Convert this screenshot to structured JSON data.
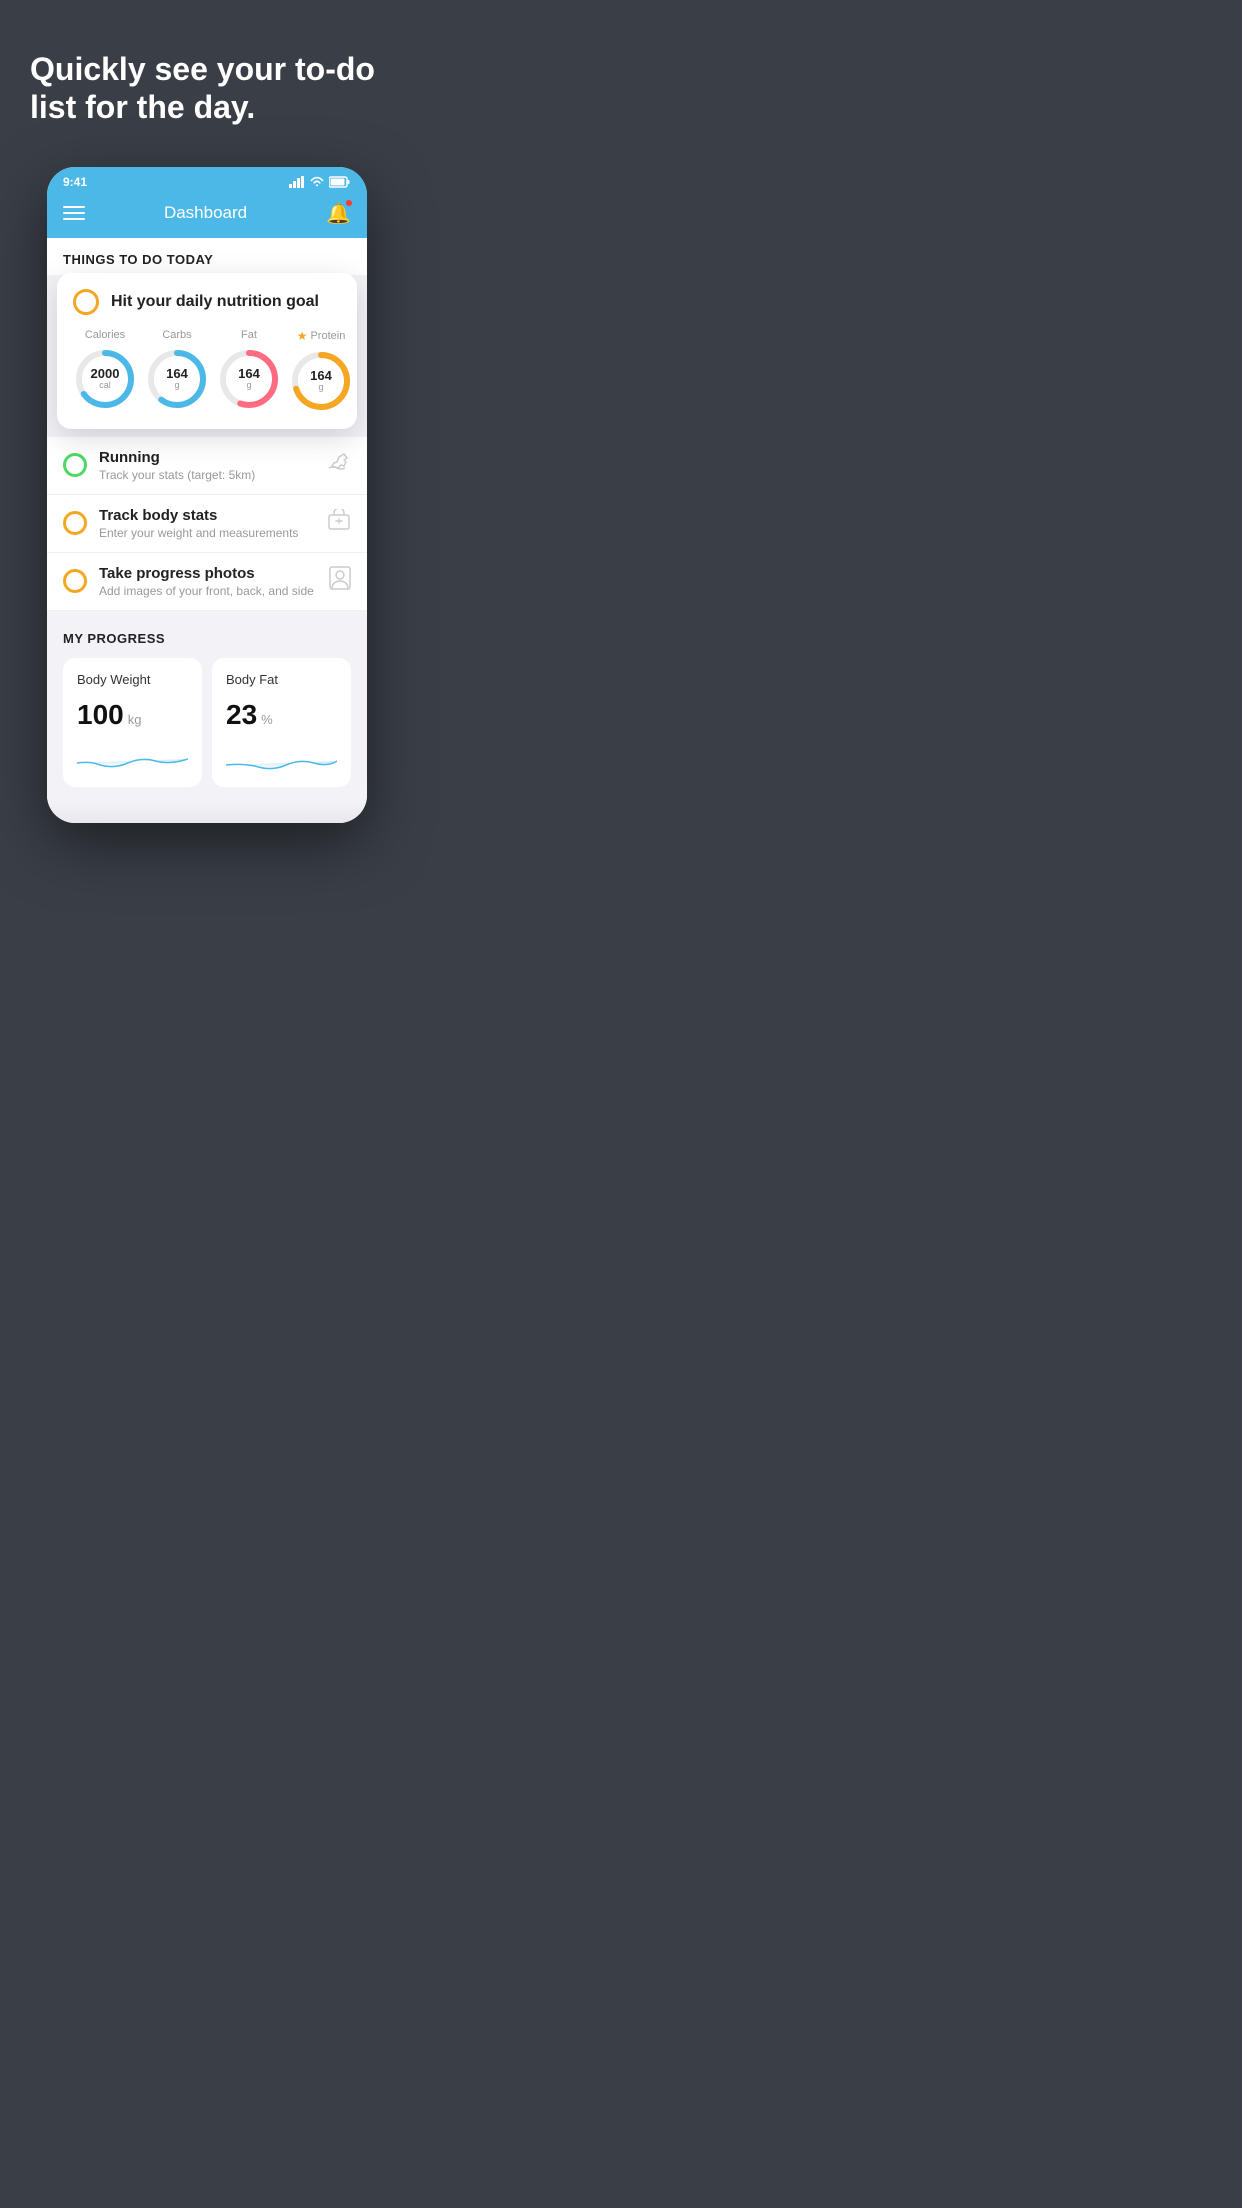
{
  "hero": {
    "title": "Quickly see your to-do list for the day."
  },
  "statusBar": {
    "time": "9:41",
    "signal": "▋▋▋▋",
    "wifi": "wifi",
    "battery": "battery"
  },
  "navBar": {
    "title": "Dashboard"
  },
  "thingsToDo": {
    "sectionTitle": "THINGS TO DO TODAY",
    "nutritionCard": {
      "title": "Hit your daily nutrition goal",
      "stats": [
        {
          "label": "Calories",
          "value": "2000",
          "unit": "cal",
          "color": "#4bb8e8",
          "percent": 65
        },
        {
          "label": "Carbs",
          "value": "164",
          "unit": "g",
          "color": "#4bb8e8",
          "percent": 60
        },
        {
          "label": "Fat",
          "value": "164",
          "unit": "g",
          "color": "#ff6b81",
          "percent": 55
        },
        {
          "label": "Protein",
          "value": "164",
          "unit": "g",
          "color": "#f5a623",
          "percent": 70,
          "starred": true
        }
      ]
    },
    "items": [
      {
        "name": "Running",
        "sub": "Track your stats (target: 5km)",
        "circleColor": "green",
        "icon": "shoe"
      },
      {
        "name": "Track body stats",
        "sub": "Enter your weight and measurements",
        "circleColor": "yellow",
        "icon": "scale"
      },
      {
        "name": "Take progress photos",
        "sub": "Add images of your front, back, and side",
        "circleColor": "yellow",
        "icon": "person"
      }
    ]
  },
  "progress": {
    "sectionTitle": "MY PROGRESS",
    "cards": [
      {
        "title": "Body Weight",
        "value": "100",
        "unit": "kg"
      },
      {
        "title": "Body Fat",
        "value": "23",
        "unit": "%"
      }
    ]
  }
}
